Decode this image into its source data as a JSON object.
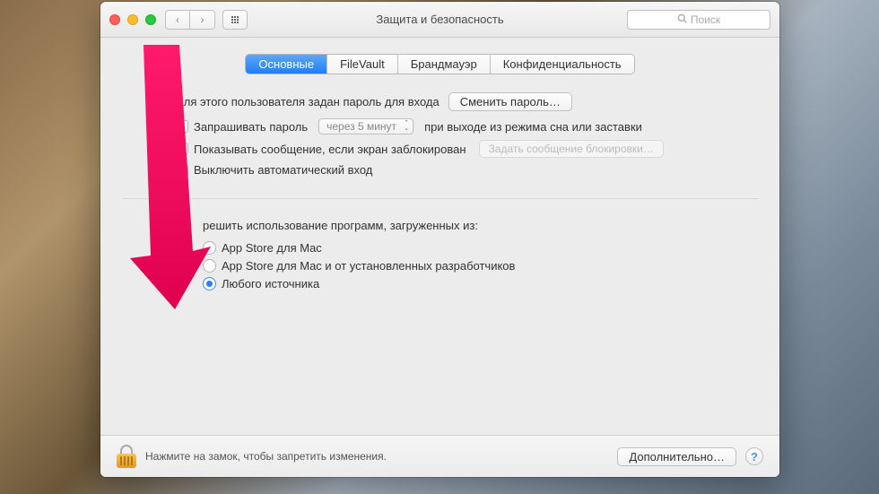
{
  "window": {
    "title": "Защита и безопасность",
    "search_placeholder": "Поиск"
  },
  "tabs": [
    {
      "label": "Основные",
      "active": true
    },
    {
      "label": "FileVault",
      "active": false
    },
    {
      "label": "Брандмауэр",
      "active": false
    },
    {
      "label": "Конфиденциальность",
      "active": false
    }
  ],
  "section1": {
    "password_label": "Для этого пользователя задан пароль для входа",
    "change_password_btn": "Сменить пароль…",
    "require_password_before": "Запрашивать пароль",
    "require_password_delay": "через 5 минут",
    "require_password_after": "при выходе из режима сна или заставки",
    "show_message": "Показывать сообщение, если экран заблокирован",
    "set_message_btn": "Задать сообщение блокировки…",
    "disable_autologin": "Выключить автоматический вход"
  },
  "section2": {
    "heading_partial": "решить использование программ, загруженных из:",
    "options": [
      {
        "label": "App Store для Mac",
        "selected": false
      },
      {
        "label": "App Store для Mac и от установленных разработчиков",
        "selected": false
      },
      {
        "label": "Любого источника",
        "selected": true
      }
    ]
  },
  "footer": {
    "lock_text": "Нажмите на замок, чтобы запретить изменения.",
    "advanced_btn": "Дополнительно…"
  }
}
